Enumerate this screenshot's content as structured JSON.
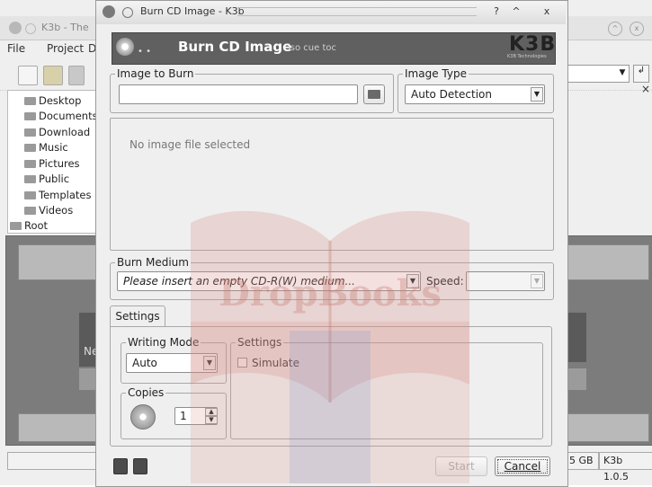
{
  "background_window": {
    "title": "K3b - The",
    "menu": [
      "File",
      "Project",
      "D"
    ],
    "tree_items": [
      "Desktop",
      "Documents",
      "Download",
      "Music",
      "Pictures",
      "Public",
      "Templates",
      "Videos",
      "Root"
    ],
    "partial_label": "Ne",
    "status_capacity": "5 GB",
    "status_version": "K3b 1.0.5"
  },
  "dialog": {
    "title": "Burn CD Image - K3b",
    "help_button": "?",
    "maximize_button": "^",
    "close_button": "x",
    "header": {
      "title": "Burn CD Image",
      "subtitle": "iso cue toc",
      "logo": "K3B",
      "logo_sub": "K3B Technologies"
    },
    "image_to_burn": {
      "label": "Image to Burn",
      "value": ""
    },
    "image_type": {
      "label": "Image Type",
      "selected": "Auto Detection"
    },
    "image_info_text": "No image file selected",
    "burn_medium": {
      "label": "Burn Medium",
      "selected": "Please insert an empty CD-R(W) medium...",
      "speed_label": "Speed:",
      "speed_value": ""
    },
    "tabs": [
      "Settings"
    ],
    "writing_mode": {
      "label": "Writing Mode",
      "selected": "Auto"
    },
    "settings_group": {
      "label": "Settings",
      "simulate_label": "Simulate",
      "simulate_checked": false
    },
    "copies": {
      "label": "Copies",
      "value": "1"
    },
    "buttons": {
      "start": "Start",
      "cancel": "Cancel"
    }
  },
  "watermark_text": "DropBooks",
  "colors": {
    "dialog_bg": "#efefef",
    "header_bg": "#606060",
    "watermark_red": "#d9908a",
    "watermark_blue": "#6e8fc9"
  }
}
